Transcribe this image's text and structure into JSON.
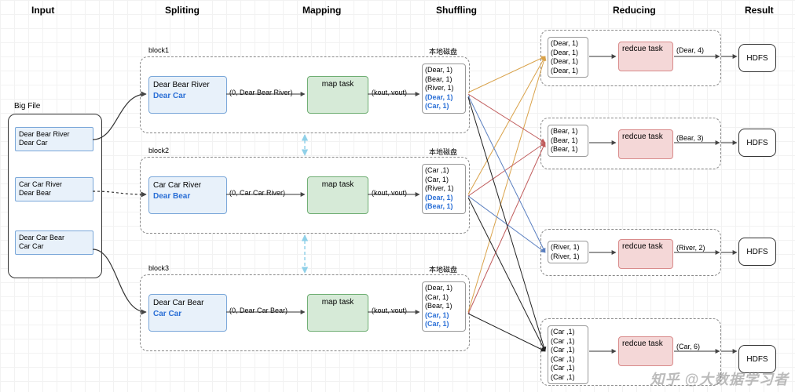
{
  "headers": {
    "input": "Input",
    "splitting": "Spliting",
    "mapping": "Mapping",
    "shuffling": "Shuffling",
    "reducing": "Reducing",
    "result": "Result"
  },
  "input": {
    "label": "Big File",
    "blocks": [
      {
        "line1": "Dear Bear River",
        "line2": "Dear Car"
      },
      {
        "line1": "Car Car River",
        "line2": "Dear Bear"
      },
      {
        "line1": "Dear Car Bear",
        "line2": "Car Car"
      }
    ]
  },
  "splits": [
    {
      "label": "block1",
      "disk": "本地磁盘",
      "text1": "Dear Bear River",
      "text2": "Dear Car",
      "kv_in": "(0, Dear Bear River)",
      "map_label": "map task",
      "kv_out": "(kout, vout)",
      "out": [
        "(Dear, 1)",
        "(Bear, 1)",
        "(River, 1)",
        "(Dear, 1)",
        "(Car, 1)"
      ],
      "out_hl": [
        false,
        false,
        false,
        true,
        true
      ]
    },
    {
      "label": "block2",
      "disk": "本地磁盘",
      "text1": "Car Car River",
      "text2": "Dear Bear",
      "kv_in": "(0, Car Car River)",
      "map_label": "map task",
      "kv_out": "(kout, vout)",
      "out": [
        "(Car ,1)",
        "(Car, 1)",
        "(River, 1)",
        "(Dear, 1)",
        "(Bear, 1)"
      ],
      "out_hl": [
        false,
        false,
        false,
        true,
        true
      ]
    },
    {
      "label": "block3",
      "disk": "本地磁盘",
      "text1": "Dear Car Bear",
      "text2": "Car Car",
      "kv_in": "(0, Dear Car Bear)",
      "map_label": "map task",
      "kv_out": "(kout, vout)",
      "out": [
        "(Dear, 1)",
        "(Car, 1)",
        "(Bear, 1)",
        "(Car, 1)",
        "(Car, 1)"
      ],
      "out_hl": [
        false,
        false,
        false,
        true,
        true
      ]
    }
  ],
  "reduces": [
    {
      "in": [
        "(Dear, 1)",
        "(Dear, 1)",
        "(Dear, 1)",
        "(Dear, 1)"
      ],
      "task": "redcue task",
      "out": "(Dear, 4)",
      "hdfs": "HDFS"
    },
    {
      "in": [
        "(Bear, 1)",
        "(Bear, 1)",
        "(Bear, 1)"
      ],
      "task": "redcue task",
      "out": "(Bear, 3)",
      "hdfs": "HDFS"
    },
    {
      "in": [
        "(River, 1)",
        "(River, 1)"
      ],
      "task": "redcue task",
      "out": "(River, 2)",
      "hdfs": "HDFS"
    },
    {
      "in": [
        "(Car ,1)",
        "(Car ,1)",
        "(Car ,1)",
        "(Car ,1)",
        "(Car ,1)",
        "(Car ,1)"
      ],
      "task": "redcue task",
      "out": "(Car, 6)",
      "hdfs": "HDFS"
    }
  ],
  "watermark": "知乎 @大数据学习者",
  "chart_data": {
    "type": "diagram",
    "title": "MapReduce word-count data flow",
    "stages": [
      "Input",
      "Spliting",
      "Mapping",
      "Shuffling",
      "Reducing",
      "Result"
    ],
    "reduce_counts": {
      "Dear": 4,
      "Bear": 3,
      "River": 2,
      "Car": 6
    }
  }
}
